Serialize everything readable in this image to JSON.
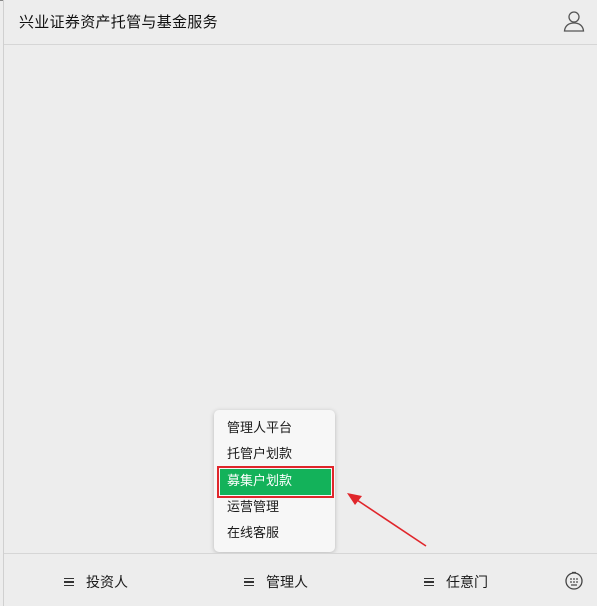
{
  "header": {
    "title": "兴业证券资产托管与基金服务",
    "user_icon": "user-icon"
  },
  "popup_menu": {
    "items": [
      {
        "label": "管理人平台"
      },
      {
        "label": "托管户划款"
      },
      {
        "label": "募集户划款",
        "selected": true
      },
      {
        "label": "运营管理"
      },
      {
        "label": "在线客服"
      }
    ]
  },
  "footer": {
    "menus": [
      {
        "label": "投资人",
        "icon": "menu-icon"
      },
      {
        "label": "管理人",
        "icon": "menu-icon"
      },
      {
        "label": "任意门",
        "icon": "menu-icon"
      }
    ],
    "keyboard_icon": "keyboard-icon"
  },
  "colors": {
    "highlight": "#13b25a",
    "annotation": "#e0262b",
    "background": "#ededed"
  }
}
